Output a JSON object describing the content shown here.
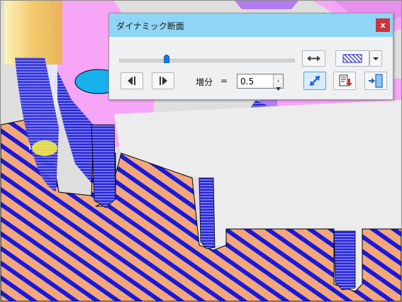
{
  "dialog": {
    "title": "ダイナミック断面",
    "close_glyph": "x",
    "slider": {
      "value_fraction": 0.27
    },
    "increment": {
      "label": "増分",
      "equals": "=",
      "value": "0.5"
    },
    "icons": {
      "expand": "horizontal-arrows-icon",
      "hatch": "hatch-pattern-icon",
      "dropdown": "chevron-down-icon",
      "step_back": "step-backward-icon",
      "step_forward": "step-forward-icon",
      "diagonal": "diagonal-arrow-icon",
      "save": "save-section-icon",
      "exit": "exit-door-icon"
    }
  },
  "colors": {
    "titlebar": "#8fd5f5",
    "close": "#c9373d",
    "section_fill": "#f4a87a",
    "hatch_line": "#1919dc",
    "part_surface": "#f7a6f7",
    "hole": "#17b1ee",
    "floor": "#dedede"
  }
}
